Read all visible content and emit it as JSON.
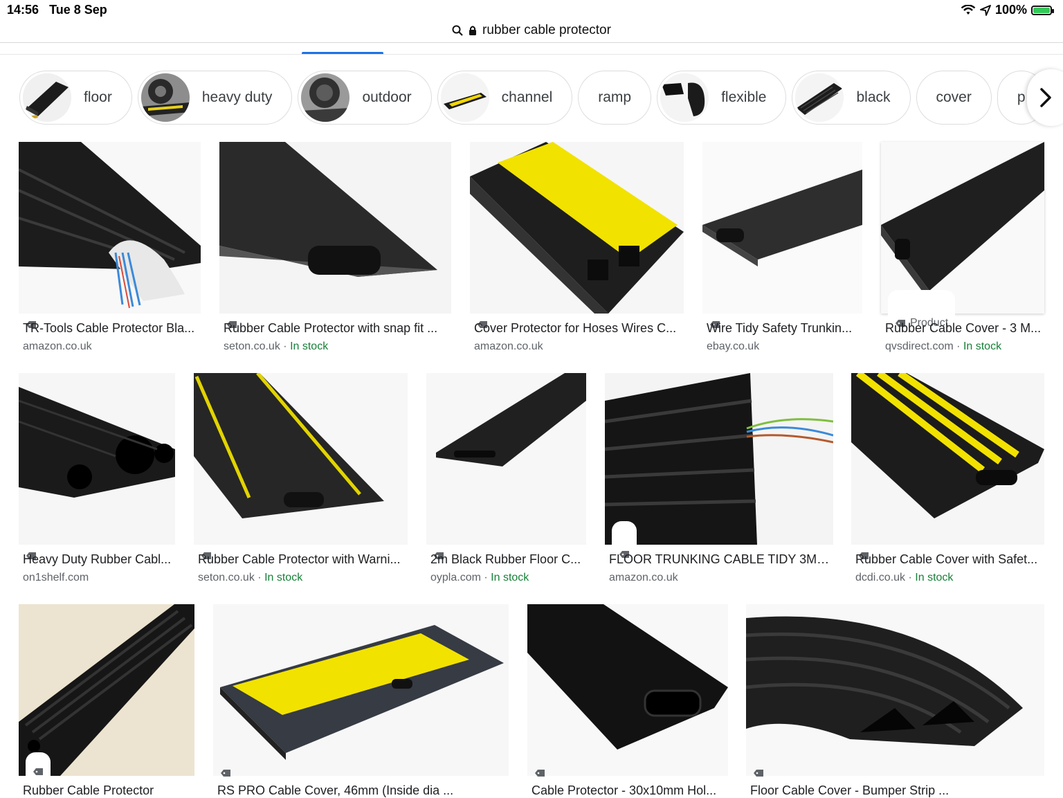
{
  "status_bar": {
    "time": "14:56",
    "date": "Tue 8 Sep",
    "battery": "100%"
  },
  "url_bar": {
    "query": "rubber cable protector"
  },
  "chips": [
    {
      "label": "floor",
      "icon": "cable-protector-thumb"
    },
    {
      "label": "heavy duty",
      "icon": "heavy-duty-thumb"
    },
    {
      "label": "outdoor",
      "icon": "outdoor-thumb"
    },
    {
      "label": "channel",
      "icon": "channel-thumb"
    },
    {
      "label": "ramp",
      "icon": ""
    },
    {
      "label": "flexible",
      "icon": "flexible-thumb"
    },
    {
      "label": "black",
      "icon": "black-thumb"
    },
    {
      "label": "cover",
      "icon": ""
    },
    {
      "label": "p",
      "icon": ""
    }
  ],
  "results": [
    {
      "title": "TR-Tools Cable Protector Bla...",
      "source": "amazon.co.uk",
      "stock": ""
    },
    {
      "title": "Rubber Cable Protector with snap fit ...",
      "source": "seton.co.uk",
      "stock": "In stock"
    },
    {
      "title": "Cover Protector for Hoses Wires C...",
      "source": "amazon.co.uk",
      "stock": ""
    },
    {
      "title": "Wire Tidy Safety Trunkin...",
      "source": "ebay.co.uk",
      "stock": ""
    },
    {
      "title": "Rubber Cable Cover - 3 M...",
      "source": "qvsdirect.com",
      "stock": "In stock",
      "tag_label": "Product"
    },
    {
      "title": "Heavy Duty Rubber Cabl...",
      "source": "on1shelf.com",
      "stock": ""
    },
    {
      "title": "Rubber Cable Protector with Warni...",
      "source": "seton.co.uk",
      "stock": "In stock"
    },
    {
      "title": "2m Black Rubber Floor C...",
      "source": "oypla.com",
      "stock": "In stock"
    },
    {
      "title": "FLOOR TRUNKING CABLE TIDY 3M L...",
      "source": "amazon.co.uk",
      "stock": ""
    },
    {
      "title": "Rubber Cable Cover with Safet...",
      "source": "dcdi.co.uk",
      "stock": "In stock"
    },
    {
      "title": "Rubber Cable Protector",
      "source": "",
      "stock": ""
    },
    {
      "title": "RS PRO Cable Cover, 46mm (Inside dia ...",
      "source": "",
      "stock": ""
    },
    {
      "title": "Cable Protector - 30x10mm Hol...",
      "source": "",
      "stock": ""
    },
    {
      "title": "Floor Cable Cover - Bumper Strip ...",
      "source": "",
      "stock": ""
    }
  ],
  "separator": "·",
  "colors": {
    "accent": "#1a73e8",
    "stock_green": "#188038",
    "rubber_black": "#1e1e1e",
    "safety_yellow": "#f2e200"
  }
}
